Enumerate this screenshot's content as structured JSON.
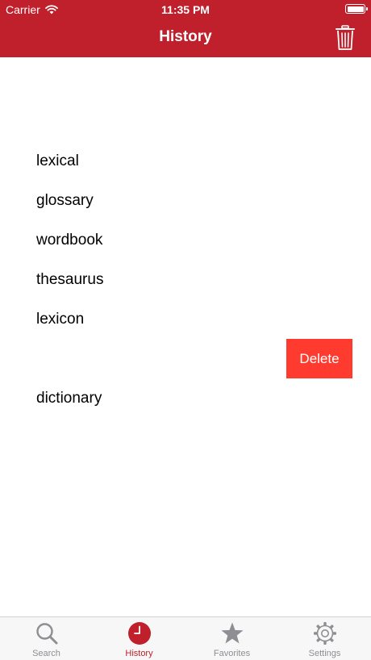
{
  "status_bar": {
    "carrier": "Carrier",
    "time": "11:35 PM"
  },
  "nav": {
    "title": "History",
    "trash_icon": "trash-icon"
  },
  "history": {
    "items": [
      {
        "label": "lexical"
      },
      {
        "label": "glossary"
      },
      {
        "label": "wordbook"
      },
      {
        "label": "thesaurus"
      },
      {
        "label": "lexicon"
      },
      {
        "label": ""
      },
      {
        "label": "dictionary"
      }
    ],
    "delete_label": "Delete"
  },
  "tabs": [
    {
      "label": "Search",
      "icon": "search-icon",
      "active": false
    },
    {
      "label": "History",
      "icon": "clock-icon",
      "active": true
    },
    {
      "label": "Favorites",
      "icon": "star-icon",
      "active": false
    },
    {
      "label": "Settings",
      "icon": "gear-icon",
      "active": false
    }
  ],
  "colors": {
    "brand": "#c01f2c",
    "delete": "#ff3b30",
    "tab_inactive": "#8e8e93"
  }
}
